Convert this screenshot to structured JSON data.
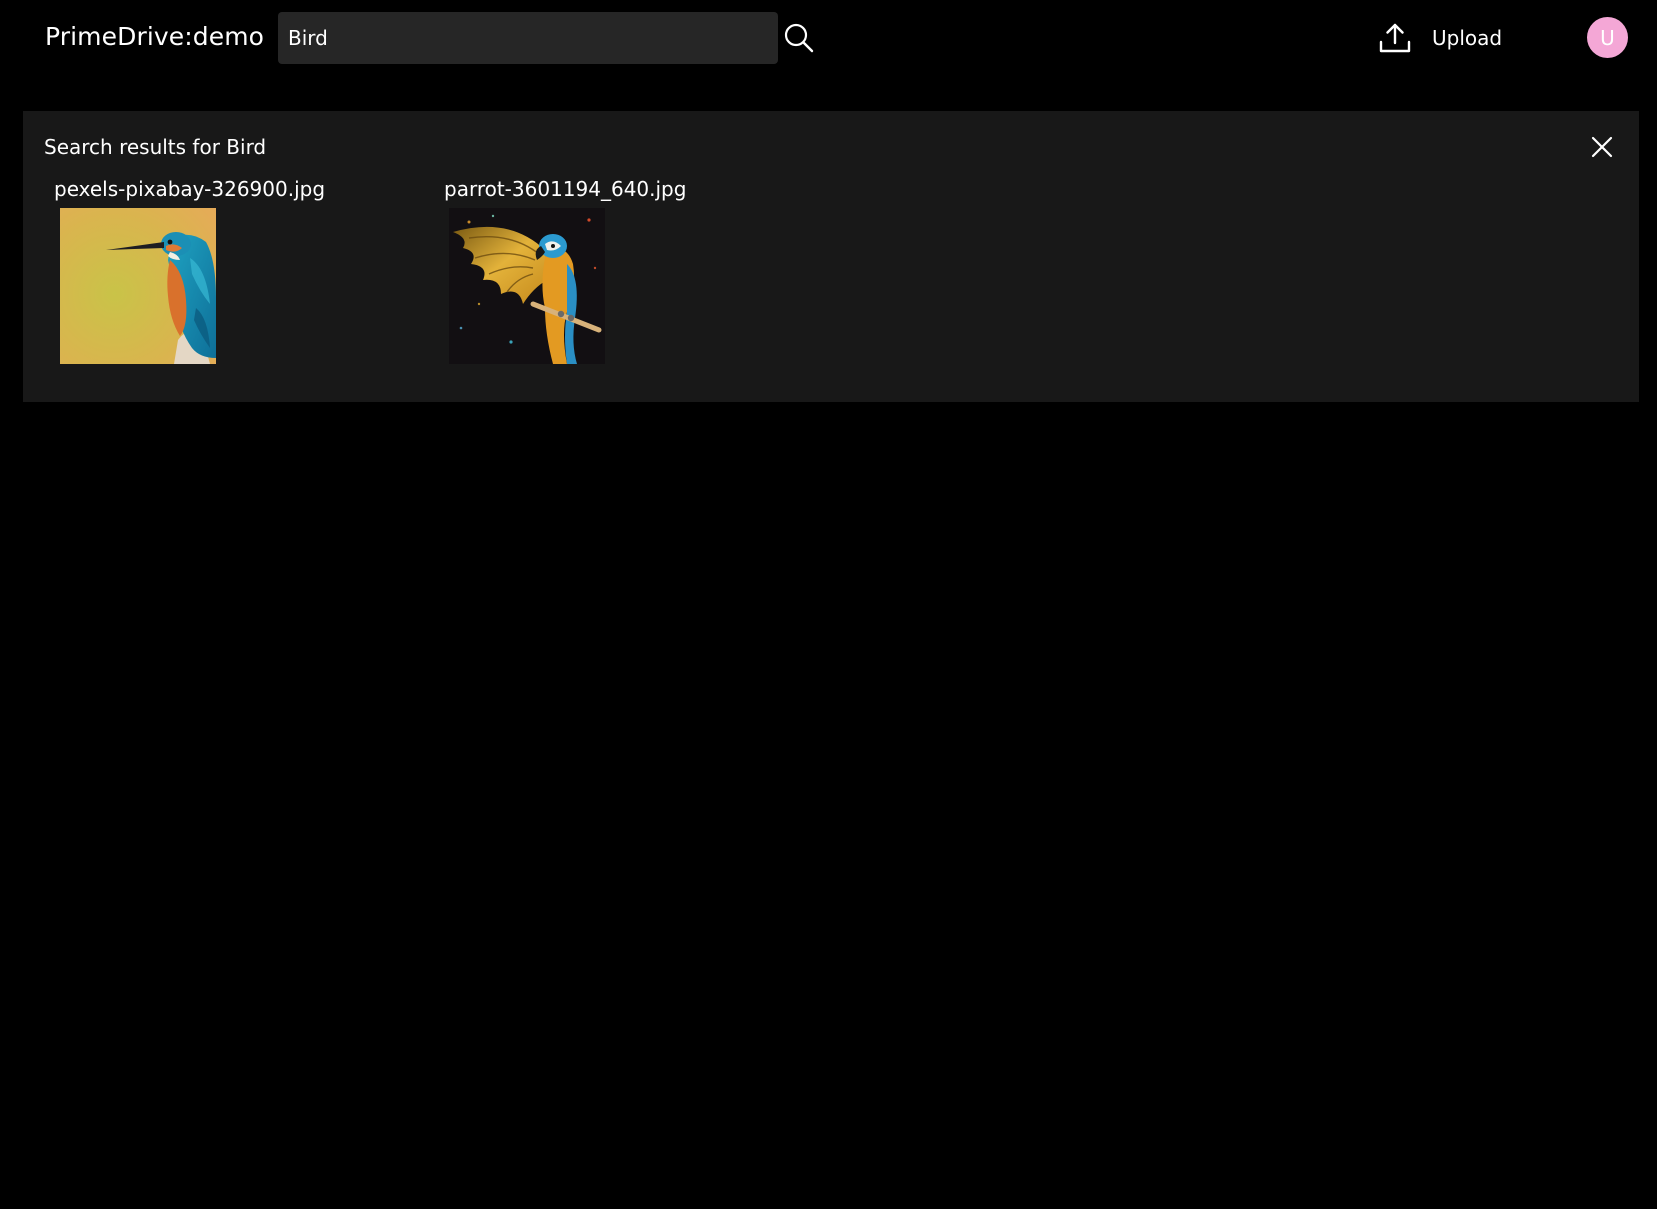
{
  "app": {
    "brand": "PrimeDrive:demo"
  },
  "search": {
    "value": "Bird",
    "icon": "search-icon"
  },
  "upload": {
    "label": "Upload",
    "icon": "upload-icon"
  },
  "user": {
    "initial": "U",
    "avatar_color": "#f4a7d6"
  },
  "results": {
    "heading": "Search results for Bird",
    "close_icon": "close-icon",
    "items": [
      {
        "filename": "pexels-pixabay-326900.jpg"
      },
      {
        "filename": "parrot-3601194_640.jpg"
      }
    ]
  },
  "colors": {
    "background": "#000000",
    "panel": "#181818",
    "search_field": "#262626",
    "text": "#ffffff"
  }
}
